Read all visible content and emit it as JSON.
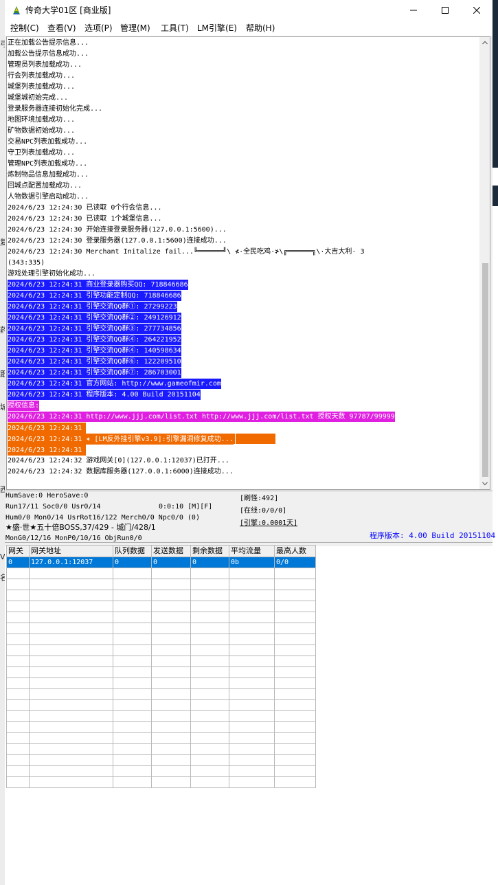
{
  "window": {
    "title": "传奇大学01区 [商业版]"
  },
  "menu": [
    "控制(C)",
    "查看(V)",
    "选项(P)",
    "管理(M)",
    "工具(T)",
    "LM引擎(E)",
    "帮助(H)"
  ],
  "log": {
    "plain_lines": [
      "正在加载公告提示信息...",
      "加载公告提示信息成功...",
      "管理员列表加载成功...",
      "行会列表加载成功...",
      "城堡列表加载成功...",
      "城堡城初始完成...",
      "登录服务器连接初始化完成...",
      "地图环境加载成功...",
      "矿物数据初始成功...",
      "交易NPC列表加载成功...",
      "守卫列表加载成功...",
      "管理NPC列表加载成功...",
      "炼制物品信息加载成功...",
      "回城点配置加载成功...",
      "人物数据引擎启动成功...",
      "2024/6/23 12:24:30 已读取 0个行会信息...",
      "2024/6/23 12:24:30 已读取 1个城堡信息...",
      "2024/6/23 12:24:30 开始连接登录服务器(127.0.0.1:5600)...",
      "2024/6/23 12:24:30 登录服务器(127.0.0.1:5600)连接成功...",
      "2024/6/23 12:24:30 Merchant Initalize fail...╚══════╝\\ ≮·全民吃鸡·≯\\╔══════╗\\·大吉大利· 3",
      "(343:335)",
      "游戏处理引擎初始化成功..."
    ],
    "blue_lines": [
      "2024/6/23 12:24:31 商业登录器购买QQ: 718846686",
      "2024/6/23 12:24:31 引擎功能定制QQ: 718846686",
      "2024/6/23 12:24:31 引擎交流QQ群①: 27299223",
      "2024/6/23 12:24:31 引擎交流QQ群②: 249126912",
      "2024/6/23 12:24:31 引擎交流QQ群③: 277734856",
      "2024/6/23 12:24:31 引擎交流QQ群④: 264221952",
      "2024/6/23 12:24:31 引擎交流QQ群④: 140598634",
      "2024/6/23 12:24:31 引擎交流QQ群⑥: 122209510",
      "2024/6/23 12:24:31 引擎交流QQ群⑦: 286703001",
      "2024/6/23 12:24:31 官方网站: http://www.gameofmir.com",
      "2024/6/23 12:24:31 程序版本: 4.00 Build 20151104"
    ],
    "auth_header": "授权信息:",
    "auth_line": "2024/6/23 12:24:31 http://www.jjj.com/list.txt http://www.jjj.com/list.txt 授权天数 97787/99999",
    "orange_lines": [
      "2024/6/23 12:24:31 ",
      "2024/6/23 12:24:31 ✶ [LM反外挂引擎v3.9]:引擎漏洞修复成功...",
      "2024/6/23 12:24:31 "
    ],
    "tail_lines": [
      "2024/6/23 12:24:32 游戏网关[0](127.0.0.1:12037)已打开...",
      "2024/6/23 12:24:32 数据库服务器(127.0.0.1:6000)连接成功..."
    ]
  },
  "status": {
    "line1": "HumSave:0 HeroSave:0",
    "line2_left": "Run17/11 Soc0/0 Usr0/14",
    "line2_right": "0:0:10 [M][F]",
    "line3": "Hum0/0 Mon0/14 UsrRot16/122 Merch0/0 Npc0/0 (0)",
    "line4": "★盛·世★五十倍BOSS,37/429 - 城门/428/1",
    "line5": "MonG0/12/16 MonP0/10/16 ObjRun0/0",
    "refresh": "[刷怪:492]",
    "online": "[在线:0/0/0]",
    "engine": "[引擎:0.0001天]",
    "version": "程序版本: 4.00 Build 20151104"
  },
  "gateway_table": {
    "headers": [
      "网关",
      "网关地址",
      "队列数据",
      "发送数据",
      "剩余数据",
      "平均流量",
      "最高人数"
    ],
    "rows": [
      [
        "0",
        "127.0.0.1:12037",
        "0",
        "0",
        "0",
        "0b",
        "0/0"
      ]
    ],
    "empty_rows": 20
  },
  "colors": {
    "blue_highlight": "#1a1aff",
    "magenta_highlight": "#e020e0",
    "orange_highlight": "#f06a00",
    "selection": "#0078d7",
    "version_text": "#0000ff"
  },
  "icons": {
    "app": "app-icon",
    "minimize": "minimize-icon",
    "maximize": "maximize-icon",
    "close": "close-icon",
    "scroll_up": "scroll-up-arrow-icon",
    "scroll_down": "scroll-down-arrow-icon"
  }
}
